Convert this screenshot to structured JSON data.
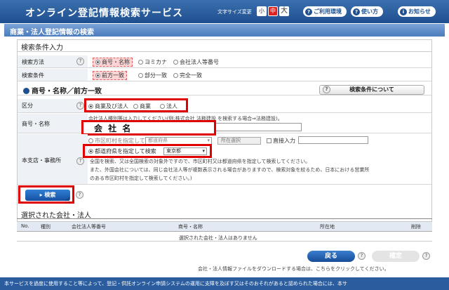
{
  "header": {
    "title": "オンライン登記情報検索サービス",
    "font_size_label": "文字サイズ変更",
    "font_small": "小",
    "font_medium": "中",
    "font_large": "大",
    "env_button": "ご利用環境",
    "howto_button": "使い方",
    "news_button": "お知らせ"
  },
  "page_title": "商業・法人登記情報の検索",
  "conditions": {
    "title": "検索条件入力",
    "method": {
      "label": "検索方法",
      "options": [
        "商号・名称",
        "ヨミカナ",
        "会社法人等番号"
      ],
      "selected": 0
    },
    "condition": {
      "label": "検索条件",
      "options": [
        "前方一致",
        "部分一致",
        "完全一致"
      ],
      "selected": 0
    }
  },
  "subsection": {
    "title": "商号・名称／前方一致",
    "about_button": "検索条件について"
  },
  "classification": {
    "label": "区分",
    "options": [
      "商業及び法人",
      "商業",
      "法人"
    ],
    "selected": 0
  },
  "name_field": {
    "label": "商号・名称",
    "hint": "会社法人種別等は入力してください(例:株式会社 法務建設 を検索する場合⇒法務建設)。",
    "value": "会 社 名"
  },
  "office": {
    "label": "本支店・事務所",
    "city_option": "市区町村を指定して検索",
    "city_select": "都道府県",
    "city_button": "所在選択",
    "direct_input": "直接入力",
    "pref_option": "都道府県を指定して検索",
    "pref_select": "東京都",
    "note1": "全国を検索、又は全国検索の対象外ですので、市区町村又は都道府県を指定して検索してください。",
    "note2": "また、外国会社については、同じ会社法人等が複数表示される場合がありますので、検索対象を絞るため、日本における営業所",
    "note3": "のある市区町村を指定して検索してください。)"
  },
  "search_button": "検索",
  "results": {
    "title": "選択された会社・法人",
    "columns": [
      "No.",
      "種別",
      "会社法人等番号",
      "商号・名称",
      "所在地",
      "削除"
    ],
    "empty_message": "選択された会社・法人はありません"
  },
  "back_button": "戻る",
  "next_button": "確定",
  "download_note": "会社・法人情報ファイルをダウンロードする場合は、こちらをクリックしてください。",
  "footer_text": "本サービスを過度に使用すること等によって、登記・供託オンライン申請システムの運用に支障を及ぼす又はそのおそれがあると認められた場合には、本サ"
}
